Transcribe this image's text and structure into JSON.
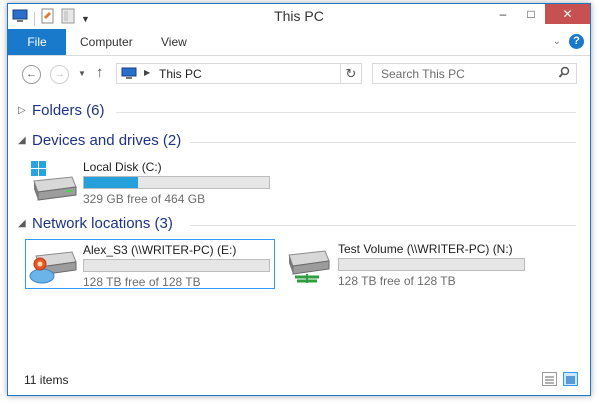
{
  "window": {
    "title": "This PC"
  },
  "ribbon": {
    "tabs": [
      "File",
      "Computer",
      "View"
    ]
  },
  "navigation": {
    "address_path": "This PC",
    "search_placeholder": "Search This PC"
  },
  "groups": {
    "folders": {
      "label": "Folders (6)",
      "expanded": false
    },
    "devices": {
      "label": "Devices and drives (2)",
      "expanded": true
    },
    "network": {
      "label": "Network locations (3)",
      "expanded": true
    }
  },
  "drives": {
    "local_disk": {
      "name": "Local Disk (C:)",
      "free_text": "329 GB free of 464 GB",
      "used_fraction": 0.29
    },
    "alex_s3": {
      "name": "Alex_S3 (\\\\WRITER-PC) (E:)",
      "free_text": "128 TB free of 128 TB",
      "used_fraction": 0.0,
      "selected": true
    },
    "test_volume": {
      "name": "Test Volume (\\\\WRITER-PC) (N:)",
      "free_text": "128 TB free of 128 TB",
      "used_fraction": 0.0
    }
  },
  "status": {
    "item_count": "11 items"
  },
  "colors": {
    "accent": "#1979ca",
    "group_text": "#1e3287",
    "bar_fill": "#26a0da",
    "selection_border": "#3399ff"
  }
}
